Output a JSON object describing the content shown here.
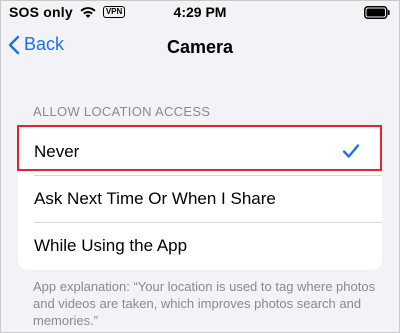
{
  "status_bar": {
    "carrier": "SOS only",
    "vpn": "VPN",
    "time": "4:29 PM",
    "icons": [
      "wifi-icon",
      "battery-icon"
    ]
  },
  "nav": {
    "back_label": "Back",
    "title": "Camera",
    "accent_color": "#1a73e8"
  },
  "section": {
    "header": "ALLOW LOCATION ACCESS",
    "options": [
      {
        "label": "Never",
        "selected": true
      },
      {
        "label": "Ask Next Time Or When I Share",
        "selected": false
      },
      {
        "label": "While Using the App",
        "selected": false
      }
    ],
    "footer": "App explanation: “Your location is used to tag where photos and videos are taken, which improves photos search and memories.”"
  },
  "annotation": {
    "highlight_color": "#e3242b"
  }
}
